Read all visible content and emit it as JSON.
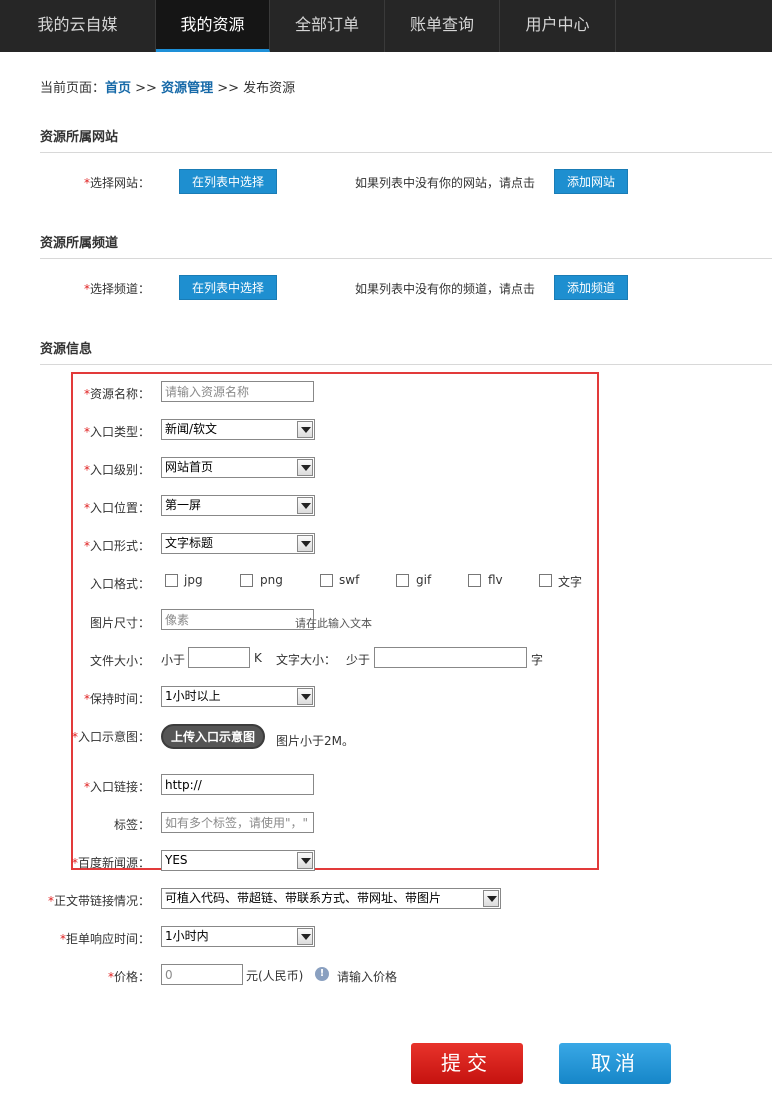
{
  "nav": {
    "items": [
      "我的云自媒",
      "我的资源",
      "全部订单",
      "账单查询",
      "用户中心"
    ],
    "active_index": 1
  },
  "breadcrumb": {
    "prefix": "当前页面：",
    "home": "首页",
    "sep1": " >> ",
    "resource_mgmt": "资源管理",
    "sep2": " >> ",
    "current": "发布资源"
  },
  "site_section": {
    "title": "资源所属网站",
    "label": "选择网站：",
    "select_button": "在列表中选择",
    "hint": "如果列表中没有你的网站，请点击",
    "add_button": "添加网站"
  },
  "channel_section": {
    "title": "资源所属频道",
    "label": "选择频道：",
    "select_button": "在列表中选择",
    "hint": "如果列表中没有你的频道，请点击",
    "add_button": "添加频道"
  },
  "info_section": {
    "title": "资源信息",
    "required_mark": "*",
    "resource_name": {
      "label": "资源名称：",
      "placeholder": "请输入资源名称"
    },
    "entry_type": {
      "label": "入口类型：",
      "value": "新闻/软文"
    },
    "entry_level": {
      "label": "入口级别：",
      "value": "网站首页"
    },
    "entry_position": {
      "label": "入口位置：",
      "value": "第一屏"
    },
    "entry_form": {
      "label": "入口形式：",
      "value": "文字标题"
    },
    "entry_format": {
      "label": "入口格式：",
      "options": [
        "jpg",
        "png",
        "swf",
        "gif",
        "flv",
        "文字"
      ]
    },
    "image_size": {
      "label": "图片尺寸：",
      "placeholder": "像素",
      "overlay_text": "请在此输入文本"
    },
    "file_size": {
      "label": "文件大小：",
      "lt": "小于",
      "unit": "K",
      "text_label": "文字大小：",
      "text_lt": "少于",
      "text_unit": "字"
    },
    "keep_time": {
      "label": "保持时间：",
      "value": "1小时以上"
    },
    "entry_image": {
      "label": "入口示意图：",
      "upload_button": "上传入口示意图",
      "note": "图片小于2M。"
    },
    "entry_link": {
      "label": "入口链接：",
      "value": "http://"
    },
    "tags": {
      "label": "标签：",
      "placeholder": "如有多个标签，请使用\"，\""
    },
    "baidu_news": {
      "label": "百度新闻源：",
      "value": "YES"
    }
  },
  "extra": {
    "body_links": {
      "label": "正文带链接情况：",
      "value": "可植入代码、带超链、带联系方式、带网址、带图片"
    },
    "reject_time": {
      "label": "拒单响应时间：",
      "value": "1小时内"
    },
    "price": {
      "label": "价格：",
      "placeholder": "0",
      "unit": "元(人民币)",
      "hint": "请输入价格"
    }
  },
  "actions": {
    "submit": "提交",
    "cancel": "取消"
  }
}
